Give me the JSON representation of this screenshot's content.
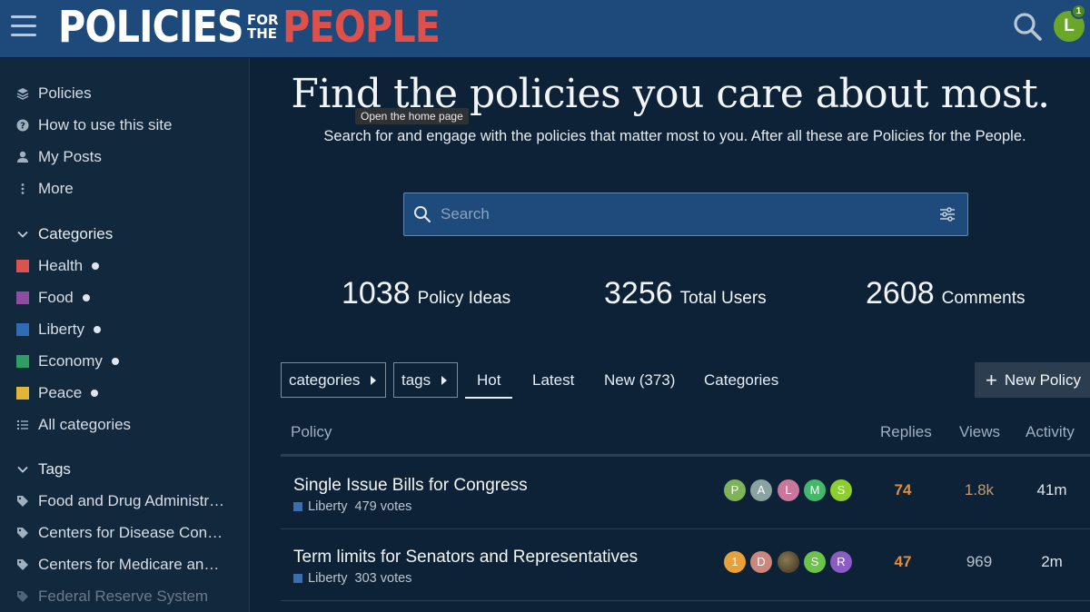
{
  "header": {
    "logo": {
      "part1": "POLICIES",
      "small_top": "FOR",
      "small_bottom": "THE",
      "part2": "PEOPLE"
    },
    "avatar_letter": "L",
    "notification_count": "1"
  },
  "sidebar": {
    "nav": [
      {
        "label": "Policies",
        "icon": "layers-icon"
      },
      {
        "label": "How to use this site",
        "icon": "question-icon"
      },
      {
        "label": "My Posts",
        "icon": "user-icon"
      },
      {
        "label": "More",
        "icon": "vertical-ellipsis-icon"
      }
    ],
    "categories_heading": "Categories",
    "categories": [
      {
        "label": "Health",
        "color": "#d9534f"
      },
      {
        "label": "Food",
        "color": "#8e4d9e"
      },
      {
        "label": "Liberty",
        "color": "#2e6db4"
      },
      {
        "label": "Economy",
        "color": "#2f9e64"
      },
      {
        "label": "Peace",
        "color": "#e2b53a"
      }
    ],
    "all_categories": "All categories",
    "tags_heading": "Tags",
    "tags": [
      {
        "label": "Food and Drug Administration"
      },
      {
        "label": "Centers for Disease Control"
      },
      {
        "label": "Centers for Medicare and Medicaid"
      },
      {
        "label": "Federal Reserve System"
      }
    ]
  },
  "hero": {
    "title": "Find the policies you care about most.",
    "tooltip": "Open the home page",
    "subtitle": "Search for and engage with the policies that matter most to you. After all these are Policies for the People."
  },
  "search": {
    "placeholder": "Search"
  },
  "stats": [
    {
      "value": "1038",
      "label": "Policy Ideas"
    },
    {
      "value": "3256",
      "label": "Total Users"
    },
    {
      "value": "2608",
      "label": "Comments"
    }
  ],
  "nav": {
    "categories_dropdown": "categories",
    "tags_dropdown": "tags",
    "tabs": [
      "Hot",
      "Latest",
      "New (373)",
      "Categories"
    ],
    "new_button": "New Policy"
  },
  "table": {
    "headers": {
      "policy": "Policy",
      "replies": "Replies",
      "views": "Views",
      "activity": "Activity"
    },
    "rows": [
      {
        "title": "Single Issue Bills for Congress",
        "category": "Liberty",
        "votes": "479 votes",
        "posters": [
          {
            "letter": "P",
            "color": "#7fb35a"
          },
          {
            "letter": "A",
            "color": "#8aa3a0"
          },
          {
            "letter": "L",
            "color": "#c9779b"
          },
          {
            "letter": "M",
            "color": "#43b86a"
          },
          {
            "letter": "S",
            "color": "#8ccf2e"
          }
        ],
        "replies": "74",
        "views": "1.8k",
        "views_color": "#c59a6e",
        "activity": "41m"
      },
      {
        "title": "Term limits for Senators and Representatives",
        "category": "Liberty",
        "votes": "303 votes",
        "posters": [
          {
            "letter": "1",
            "color": "#e8a13a"
          },
          {
            "letter": "D",
            "color": "#c9877e"
          },
          {
            "letter": "",
            "color": "#6b5b3a"
          },
          {
            "letter": "S",
            "color": "#6cc24a"
          },
          {
            "letter": "R",
            "color": "#8a5cc4"
          }
        ],
        "replies": "47",
        "views": "969",
        "views_color": "#b8c4d0",
        "activity": "2m"
      }
    ]
  }
}
